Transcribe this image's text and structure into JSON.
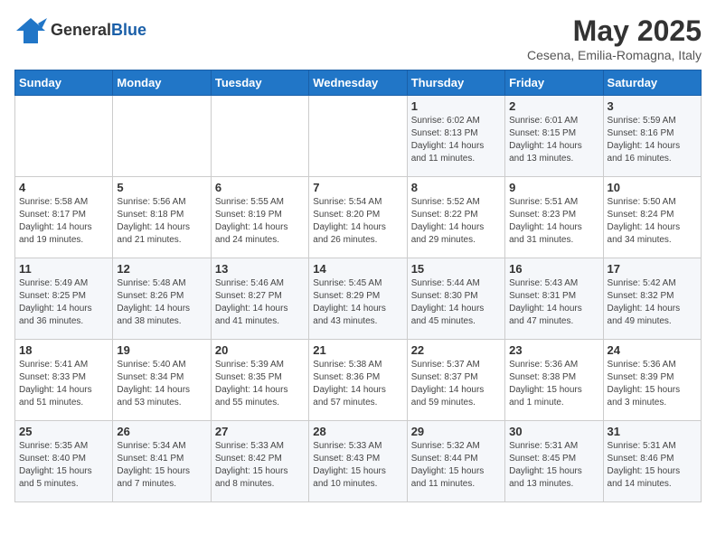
{
  "logo": {
    "general": "General",
    "blue": "Blue"
  },
  "title": "May 2025",
  "location": "Cesena, Emilia-Romagna, Italy",
  "weekdays": [
    "Sunday",
    "Monday",
    "Tuesday",
    "Wednesday",
    "Thursday",
    "Friday",
    "Saturday"
  ],
  "weeks": [
    [
      {
        "day": "",
        "info": ""
      },
      {
        "day": "",
        "info": ""
      },
      {
        "day": "",
        "info": ""
      },
      {
        "day": "",
        "info": ""
      },
      {
        "day": "1",
        "info": "Sunrise: 6:02 AM\nSunset: 8:13 PM\nDaylight: 14 hours\nand 11 minutes."
      },
      {
        "day": "2",
        "info": "Sunrise: 6:01 AM\nSunset: 8:15 PM\nDaylight: 14 hours\nand 13 minutes."
      },
      {
        "day": "3",
        "info": "Sunrise: 5:59 AM\nSunset: 8:16 PM\nDaylight: 14 hours\nand 16 minutes."
      }
    ],
    [
      {
        "day": "4",
        "info": "Sunrise: 5:58 AM\nSunset: 8:17 PM\nDaylight: 14 hours\nand 19 minutes."
      },
      {
        "day": "5",
        "info": "Sunrise: 5:56 AM\nSunset: 8:18 PM\nDaylight: 14 hours\nand 21 minutes."
      },
      {
        "day": "6",
        "info": "Sunrise: 5:55 AM\nSunset: 8:19 PM\nDaylight: 14 hours\nand 24 minutes."
      },
      {
        "day": "7",
        "info": "Sunrise: 5:54 AM\nSunset: 8:20 PM\nDaylight: 14 hours\nand 26 minutes."
      },
      {
        "day": "8",
        "info": "Sunrise: 5:52 AM\nSunset: 8:22 PM\nDaylight: 14 hours\nand 29 minutes."
      },
      {
        "day": "9",
        "info": "Sunrise: 5:51 AM\nSunset: 8:23 PM\nDaylight: 14 hours\nand 31 minutes."
      },
      {
        "day": "10",
        "info": "Sunrise: 5:50 AM\nSunset: 8:24 PM\nDaylight: 14 hours\nand 34 minutes."
      }
    ],
    [
      {
        "day": "11",
        "info": "Sunrise: 5:49 AM\nSunset: 8:25 PM\nDaylight: 14 hours\nand 36 minutes."
      },
      {
        "day": "12",
        "info": "Sunrise: 5:48 AM\nSunset: 8:26 PM\nDaylight: 14 hours\nand 38 minutes."
      },
      {
        "day": "13",
        "info": "Sunrise: 5:46 AM\nSunset: 8:27 PM\nDaylight: 14 hours\nand 41 minutes."
      },
      {
        "day": "14",
        "info": "Sunrise: 5:45 AM\nSunset: 8:29 PM\nDaylight: 14 hours\nand 43 minutes."
      },
      {
        "day": "15",
        "info": "Sunrise: 5:44 AM\nSunset: 8:30 PM\nDaylight: 14 hours\nand 45 minutes."
      },
      {
        "day": "16",
        "info": "Sunrise: 5:43 AM\nSunset: 8:31 PM\nDaylight: 14 hours\nand 47 minutes."
      },
      {
        "day": "17",
        "info": "Sunrise: 5:42 AM\nSunset: 8:32 PM\nDaylight: 14 hours\nand 49 minutes."
      }
    ],
    [
      {
        "day": "18",
        "info": "Sunrise: 5:41 AM\nSunset: 8:33 PM\nDaylight: 14 hours\nand 51 minutes."
      },
      {
        "day": "19",
        "info": "Sunrise: 5:40 AM\nSunset: 8:34 PM\nDaylight: 14 hours\nand 53 minutes."
      },
      {
        "day": "20",
        "info": "Sunrise: 5:39 AM\nSunset: 8:35 PM\nDaylight: 14 hours\nand 55 minutes."
      },
      {
        "day": "21",
        "info": "Sunrise: 5:38 AM\nSunset: 8:36 PM\nDaylight: 14 hours\nand 57 minutes."
      },
      {
        "day": "22",
        "info": "Sunrise: 5:37 AM\nSunset: 8:37 PM\nDaylight: 14 hours\nand 59 minutes."
      },
      {
        "day": "23",
        "info": "Sunrise: 5:36 AM\nSunset: 8:38 PM\nDaylight: 15 hours\nand 1 minute."
      },
      {
        "day": "24",
        "info": "Sunrise: 5:36 AM\nSunset: 8:39 PM\nDaylight: 15 hours\nand 3 minutes."
      }
    ],
    [
      {
        "day": "25",
        "info": "Sunrise: 5:35 AM\nSunset: 8:40 PM\nDaylight: 15 hours\nand 5 minutes."
      },
      {
        "day": "26",
        "info": "Sunrise: 5:34 AM\nSunset: 8:41 PM\nDaylight: 15 hours\nand 7 minutes."
      },
      {
        "day": "27",
        "info": "Sunrise: 5:33 AM\nSunset: 8:42 PM\nDaylight: 15 hours\nand 8 minutes."
      },
      {
        "day": "28",
        "info": "Sunrise: 5:33 AM\nSunset: 8:43 PM\nDaylight: 15 hours\nand 10 minutes."
      },
      {
        "day": "29",
        "info": "Sunrise: 5:32 AM\nSunset: 8:44 PM\nDaylight: 15 hours\nand 11 minutes."
      },
      {
        "day": "30",
        "info": "Sunrise: 5:31 AM\nSunset: 8:45 PM\nDaylight: 15 hours\nand 13 minutes."
      },
      {
        "day": "31",
        "info": "Sunrise: 5:31 AM\nSunset: 8:46 PM\nDaylight: 15 hours\nand 14 minutes."
      }
    ]
  ]
}
